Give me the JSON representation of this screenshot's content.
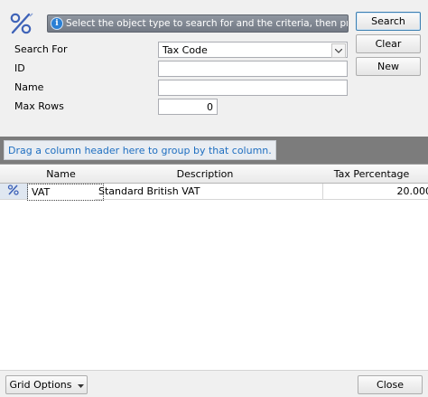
{
  "header": {
    "icon": "percent-icon",
    "info_text": "Select the object type to search for and the criteria, then press Se..."
  },
  "buttons": {
    "search": "Search",
    "clear": "Clear",
    "new": "New"
  },
  "form": {
    "search_for_label": "Search For",
    "search_for_value": "Tax Code",
    "id_label": "ID",
    "id_value": "",
    "name_label": "Name",
    "name_value": "",
    "max_rows_label": "Max Rows",
    "max_rows_value": "0"
  },
  "group_panel": {
    "hint": "Drag a column header here to group by that column."
  },
  "grid": {
    "columns": [
      "Name",
      "Description",
      "Tax Percentage"
    ],
    "rows": [
      {
        "icon": "percent-icon",
        "name": "VAT",
        "description": "Standard British VAT",
        "tax_percentage": "20.000"
      }
    ]
  },
  "footer": {
    "grid_options": "Grid Options",
    "close": "Close"
  }
}
